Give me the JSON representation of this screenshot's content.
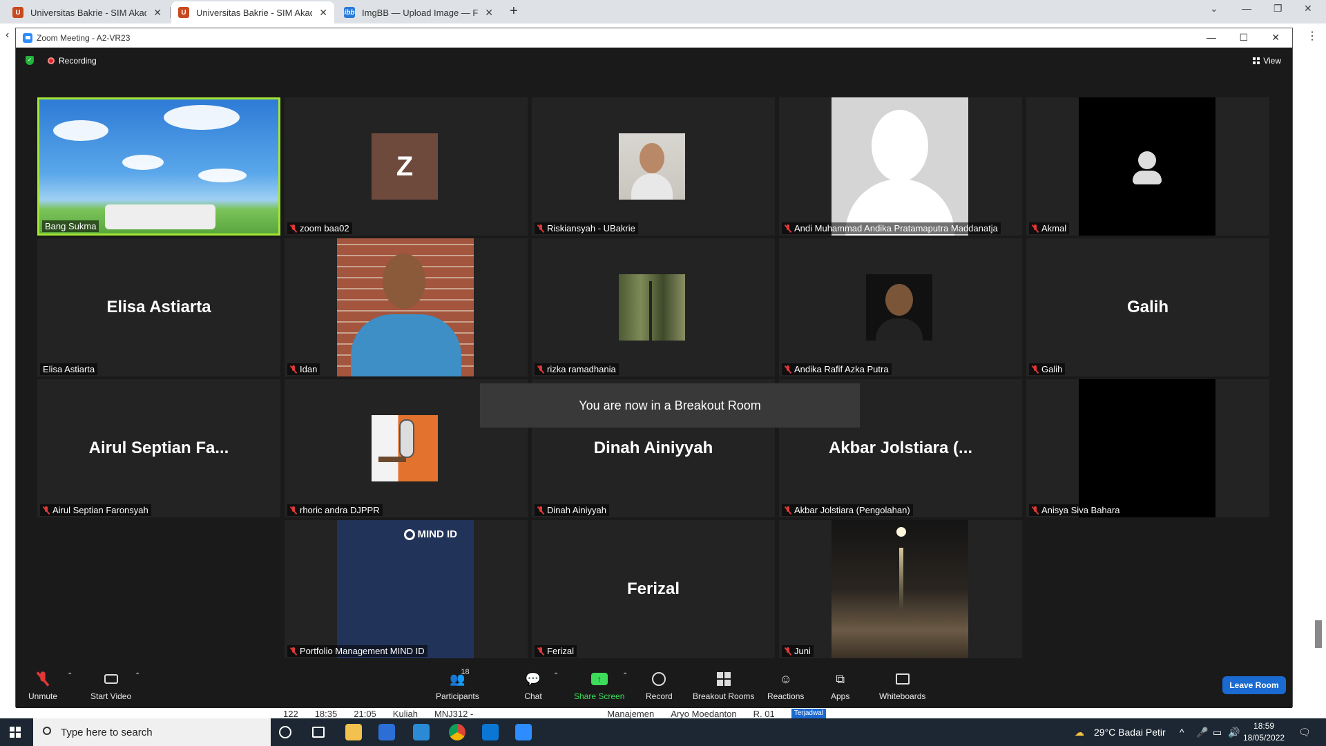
{
  "browser": {
    "tabs": [
      {
        "title": "Universitas Bakrie - SIM Akadem",
        "favicon": "ub-shield-icon",
        "active": false
      },
      {
        "title": "Universitas Bakrie - SIM Akadem",
        "favicon": "ub-shield-icon",
        "active": true
      },
      {
        "title": "ImgBB — Upload Image — Free",
        "favicon": "imgbb-icon",
        "active": false
      }
    ],
    "new_tab": "+"
  },
  "background_row": [
    "122",
    "18:35",
    "21:05",
    "Kuliah",
    "MNJ312 -",
    "Manajemen",
    "Aryo Moedanton",
    "R. 01",
    "Terjadwal"
  ],
  "zoom": {
    "window_title": "Zoom Meeting - A2-VR23",
    "recording_label": "Recording",
    "view_label": "View",
    "toast": "You are now in a Breakout Room",
    "tiles": [
      {
        "name": "Bang Sukma",
        "muted": false,
        "kind": "sky",
        "active": true
      },
      {
        "name": "zoom baa02",
        "muted": true,
        "kind": "letter",
        "letter": "Z"
      },
      {
        "name": "Riskiansyah - UBakrie",
        "muted": true,
        "kind": "photo-small"
      },
      {
        "name": "Andi Muhammad Andika Pratamaputra Maddanatja",
        "muted": true,
        "kind": "silhouette"
      },
      {
        "name": "Akmal",
        "muted": true,
        "kind": "default-avatar"
      },
      {
        "name": "Elisa Astiarta",
        "muted": false,
        "kind": "text",
        "display": "Elisa Astiarta"
      },
      {
        "name": "Idan",
        "muted": true,
        "kind": "photo-large"
      },
      {
        "name": "rizka ramadhania",
        "muted": true,
        "kind": "photo-small-trees"
      },
      {
        "name": "Andika Rafif Azka Putra",
        "muted": true,
        "kind": "photo-small-dark"
      },
      {
        "name": "Galih",
        "muted": true,
        "kind": "text",
        "display": "Galih"
      },
      {
        "name": "Airul Septian Faronsyah",
        "muted": true,
        "kind": "text",
        "display": "Airul Septian Fa..."
      },
      {
        "name": "rhoric andra DJPPR",
        "muted": true,
        "kind": "photo-small-office"
      },
      {
        "name": "Dinah Ainiyyah",
        "muted": true,
        "kind": "text",
        "display": "Dinah Ainiyyah"
      },
      {
        "name": "Akbar Jolstiara (Pengolahan)",
        "muted": true,
        "kind": "text",
        "display": "Akbar Jolstiara (..."
      },
      {
        "name": "Anisya Siva Bahara",
        "muted": true,
        "kind": "black"
      },
      {
        "name": "Portfolio Management MIND ID",
        "muted": true,
        "kind": "mindid",
        "logo_text": "MIND ID"
      },
      {
        "name": "Ferizal",
        "muted": true,
        "kind": "text",
        "display": "Ferizal"
      },
      {
        "name": "Juni",
        "muted": true,
        "kind": "night"
      }
    ],
    "toolbar": {
      "unmute": "Unmute",
      "start_video": "Start Video",
      "participants": "Participants",
      "participants_count": "18",
      "chat": "Chat",
      "share_screen": "Share Screen",
      "record": "Record",
      "breakout_rooms": "Breakout Rooms",
      "reactions": "Reactions",
      "apps": "Apps",
      "whiteboards": "Whiteboards",
      "leave_room": "Leave Room"
    }
  },
  "taskbar": {
    "search_placeholder": "Type here to search",
    "weather": "29°C  Badai Petir",
    "time": "18:59",
    "date": "18/05/2022"
  }
}
